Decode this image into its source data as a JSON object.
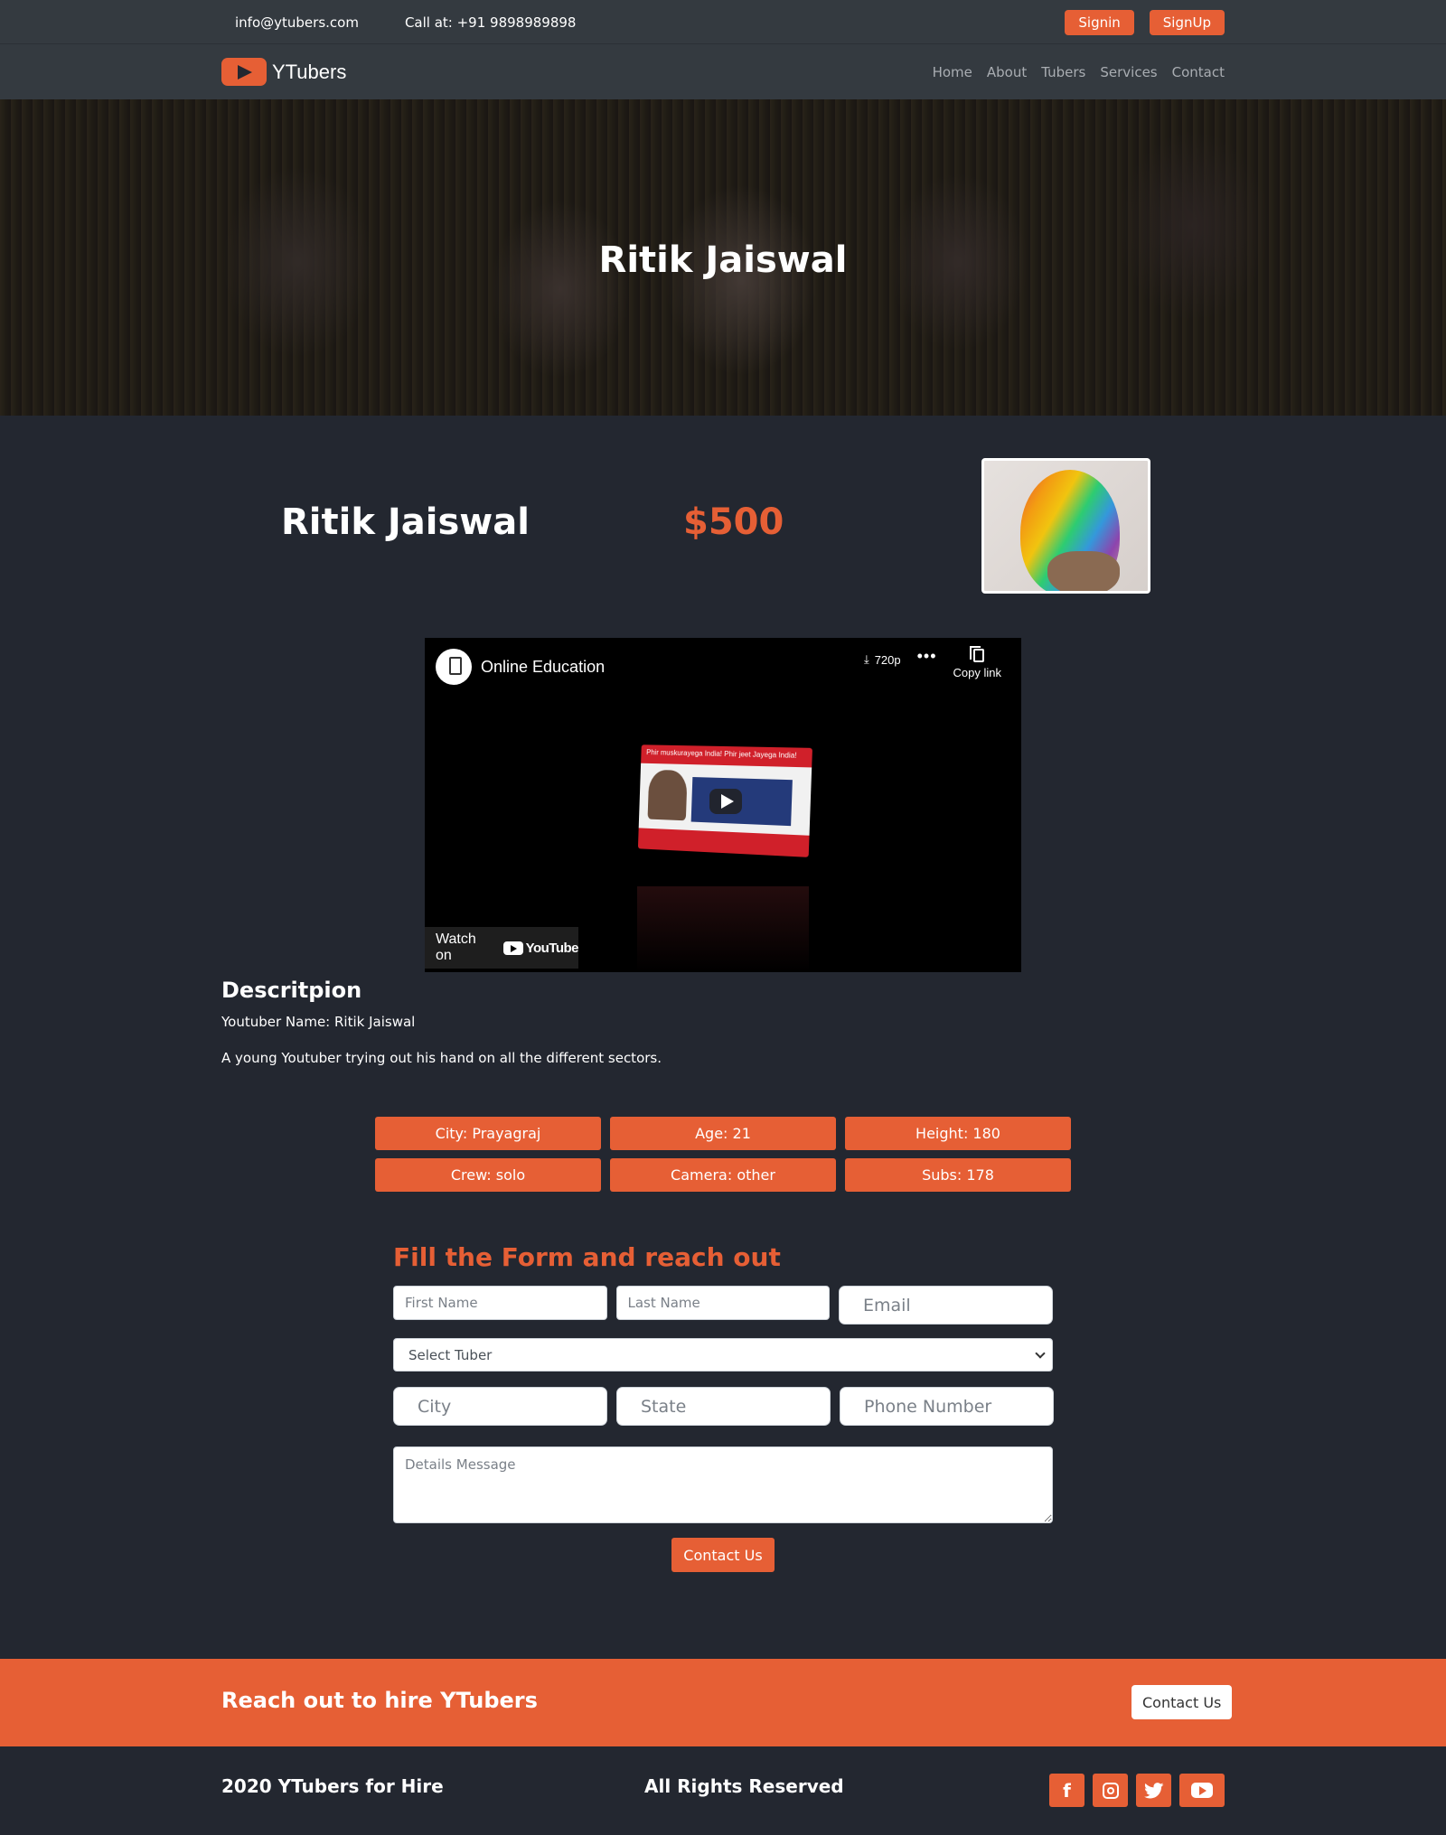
{
  "topbar": {
    "email": "info@ytubers.com",
    "phone": "Call at: +91 9898989898",
    "signin_label": "Signin",
    "signup_label": "SignUp"
  },
  "nav": {
    "brand": "YTubers",
    "links": [
      "Home",
      "About",
      "Tubers",
      "Services",
      "Contact"
    ]
  },
  "hero": {
    "title": "Ritik Jaiswal"
  },
  "profile": {
    "name": "Ritik Jaiswal",
    "price": "$500"
  },
  "video": {
    "channel_title": "Online Education",
    "quality": "720p",
    "copy_link_label": "Copy link",
    "thumbnail_ticker": "Phir muskurayega India! Phir jeet Jayega India!",
    "watch_on_label": "Watch on",
    "youtube_label": "YouTube"
  },
  "description": {
    "heading": "Descritpion",
    "name_line": "Youtuber Name: Ritik Jaiswal",
    "bio": "A young Youtuber trying out his hand on all the different sectors."
  },
  "stats": [
    "City: Prayagraj",
    "Age: 21",
    "Height: 180",
    "Crew: solo",
    "Camera: other",
    "Subs: 178"
  ],
  "form": {
    "heading": "Fill the Form and reach out",
    "first_name_placeholder": "First Name",
    "last_name_placeholder": "Last Name",
    "email_placeholder": "Email",
    "select_tuber_value": "Select Tuber",
    "city_placeholder": "City",
    "state_placeholder": "State",
    "phone_placeholder": "Phone Number",
    "message_placeholder": "Details Message",
    "submit_label": "Contact Us"
  },
  "cta": {
    "title": "Reach out to hire YTubers",
    "button_label": "Contact Us"
  },
  "footer": {
    "copyright": "2020 YTubers for Hire",
    "rights": "All Rights Reserved",
    "social_icons": [
      "facebook-icon",
      "instagram-icon",
      "twitter-icon",
      "youtube-icon"
    ]
  },
  "colors": {
    "accent": "#e65f35",
    "background": "#232730",
    "navbar": "#343a40"
  }
}
